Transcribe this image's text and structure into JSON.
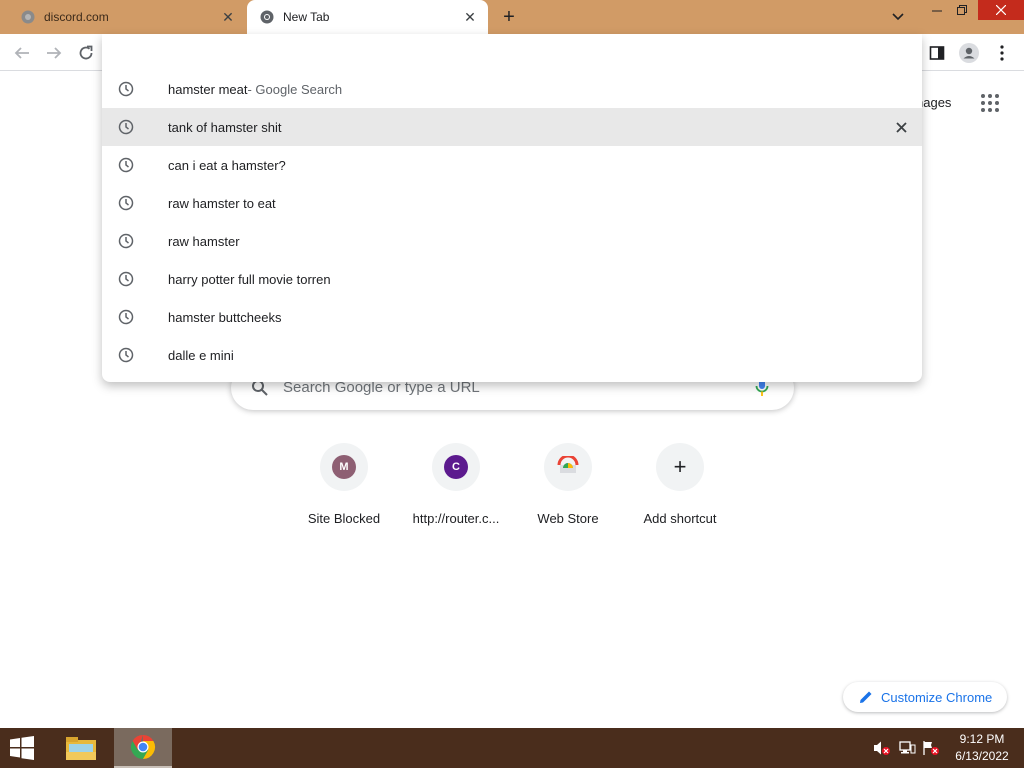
{
  "window": {
    "tabs": [
      {
        "title": "discord.com",
        "active": false
      },
      {
        "title": "New Tab",
        "active": true
      }
    ],
    "new_tab_symbol": "+",
    "close_symbol": "✕"
  },
  "toolbar": {
    "icons": [
      "back-arrow-icon",
      "forward-arrow-icon",
      "reload-icon",
      "side-panel-icon",
      "profile-icon",
      "kebab-menu-icon"
    ]
  },
  "omnibox": {
    "value": "",
    "suggestions": [
      {
        "text": "hamster meat",
        "suffix": " - Google Search",
        "selected": false
      },
      {
        "text": "tank of hamster shit",
        "suffix": "",
        "selected": true
      },
      {
        "text": "can i eat a hamster?",
        "suffix": "",
        "selected": false
      },
      {
        "text": "raw hamster to eat",
        "suffix": "",
        "selected": false
      },
      {
        "text": "raw hamster",
        "suffix": "",
        "selected": false
      },
      {
        "text": "harry potter full movie torren",
        "suffix": "",
        "selected": false
      },
      {
        "text": "hamster buttcheeks",
        "suffix": "",
        "selected": false
      },
      {
        "text": "dalle e mini",
        "suffix": "",
        "selected": false
      }
    ]
  },
  "ntp": {
    "images_link": "nages",
    "search_placeholder": "Search Google or type a URL",
    "shortcuts": [
      {
        "label": "Site Blocked",
        "letter": "M",
        "color": "#8e5f73"
      },
      {
        "label": "http://router.c...",
        "letter": "C",
        "color": "#5c1a8e"
      },
      {
        "label": "Web Store",
        "letter": "",
        "color": ""
      },
      {
        "label": "Add shortcut",
        "letter": "+",
        "color": ""
      }
    ],
    "customize_label": "Customize Chrome"
  },
  "taskbar": {
    "time": "9:12 PM",
    "date": "6/13/2022"
  },
  "colors": {
    "tabbar": "#d19b66",
    "taskbar": "#4a2d1c",
    "accent_blue": "#1a73e8",
    "close_red": "#c42b1c"
  }
}
